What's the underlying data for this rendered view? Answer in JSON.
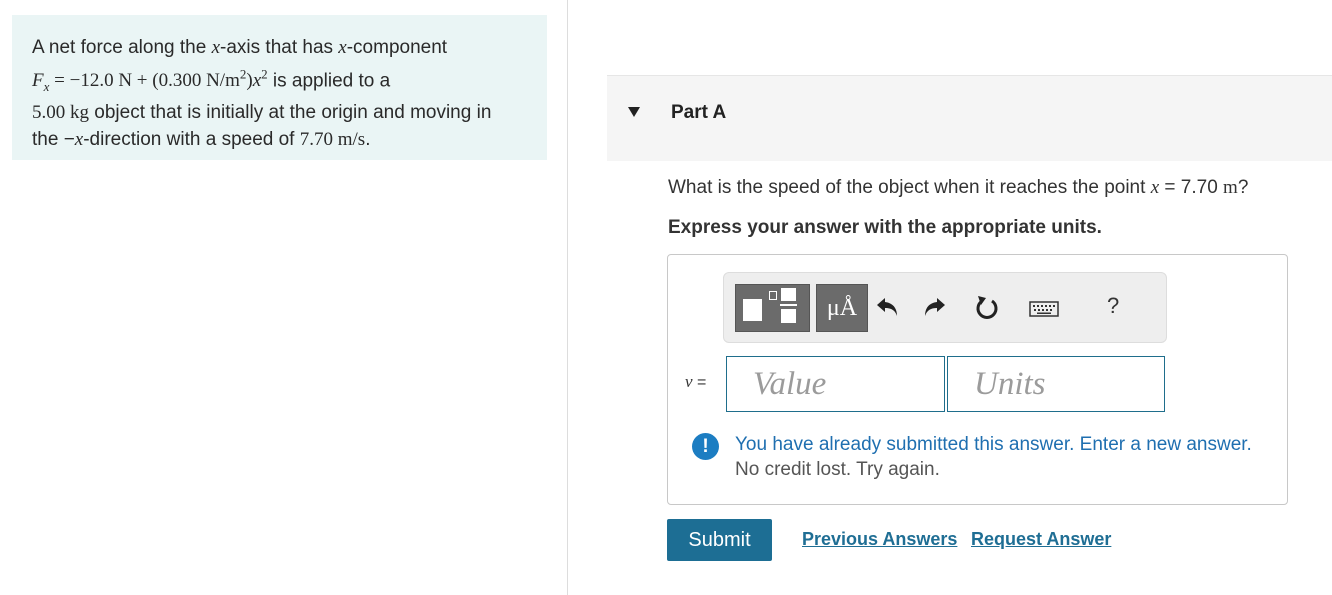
{
  "problem": {
    "line1_prefix": "A net force along the ",
    "line1_var1": "x",
    "line1_mid": "-axis that has ",
    "line1_var2": "x",
    "line1_suffix": "-component",
    "force_lhs": "F",
    "force_sub": "x",
    "force_eq": " = −12.0 N + (0.300 N/m",
    "force_exp1": "2",
    "force_close": ")",
    "force_var": "x",
    "force_exp2": "2",
    "line2_suffix": " is applied to a",
    "mass": "5.00 kg",
    "line3_suffix": " object that is initially at the origin and moving in",
    "line4_prefix": "the −",
    "line4_var": "x",
    "line4_mid": "-direction with a speed of ",
    "speed": "7.70 m/s",
    "line4_end": "."
  },
  "part": {
    "title": "Part A"
  },
  "question": {
    "prefix": "What is the speed of the object when it reaches the point ",
    "var": "x",
    "eq": " = 7.70 ",
    "unit": "m",
    "end": "?"
  },
  "instruction": "Express your answer with the appropriate units.",
  "toolbar": {
    "units_label": "μÅ",
    "help_label": "?",
    "icons": [
      "templates-icon",
      "units-icon",
      "undo-icon",
      "redo-icon",
      "reset-icon",
      "keyboard-icon",
      "help-icon"
    ]
  },
  "answer": {
    "variable": "v",
    "equals": " =",
    "value_placeholder": "Value",
    "units_placeholder": "Units"
  },
  "feedback": {
    "icon_glyph": "!",
    "line1": "You have already submitted this answer. Enter a new answer.",
    "line2": "No credit lost. Try again."
  },
  "actions": {
    "submit_label": "Submit",
    "previous_label": "Previous Answers",
    "request_label": "Request Answer"
  },
  "colors": {
    "problem_bg": "#eaf5f5",
    "accent": "#1d6e94",
    "feedback_icon": "#1c7dc2",
    "feedback_text": "#1f6fb0"
  }
}
